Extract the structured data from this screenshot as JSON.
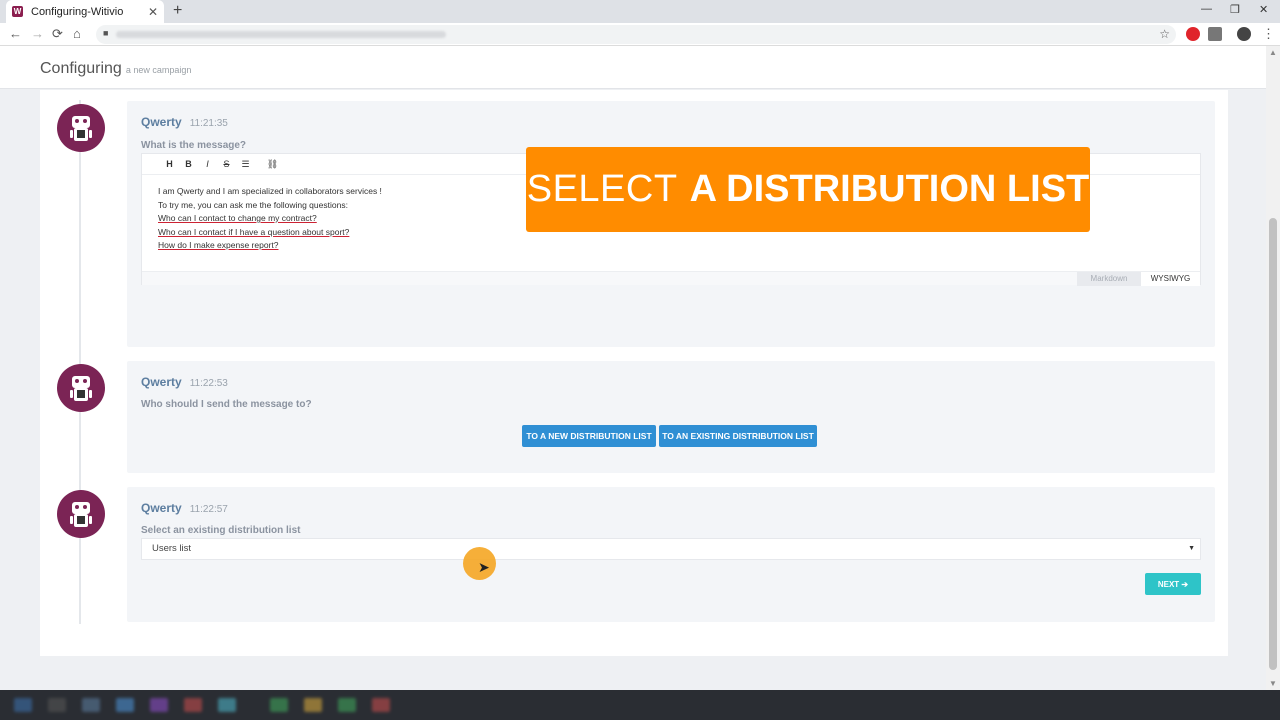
{
  "browser": {
    "tab_title": "Configuring-Witivio",
    "tab_close": "✕",
    "new_tab": "+",
    "favicon_letter": "W",
    "window_controls": [
      "—",
      "❐",
      "✕"
    ]
  },
  "header": {
    "title": "Configuring",
    "subtitle": "a new campaign"
  },
  "messages": [
    {
      "author": "Qwerty",
      "time": "11:21:35",
      "question": "What is the message?",
      "editor": {
        "toolbar": [
          "H",
          "B",
          "I",
          "S",
          "☰",
          "⛓"
        ],
        "lines": [
          "I am Qwerty and I am specialized in collaborators services !",
          "To try me, you can ask me the following questions:",
          "Who can I contact to change my contract?",
          "Who can I contact if I have a question about sport?",
          "How do I make expense report?"
        ],
        "modes": [
          "Markdown",
          "WYSIWYG"
        ]
      }
    },
    {
      "author": "Qwerty",
      "time": "11:22:53",
      "question": "Who should I send the message to?",
      "buttons": [
        "TO A NEW DISTRIBUTION LIST",
        "TO AN EXISTING DISTRIBUTION LIST"
      ]
    },
    {
      "author": "Qwerty",
      "time": "11:22:57",
      "question": "Select an existing distribution list",
      "select_value": "Users list",
      "next_label": "NEXT ➔"
    }
  ],
  "banner": {
    "light": "SELECT",
    "bold": "A DISTRIBUTION LIST"
  },
  "colors": {
    "accent": "#ff8c00",
    "avatar": "#7b2455",
    "primary_button": "#2f8fd4",
    "next_button": "#2ec4c8"
  }
}
